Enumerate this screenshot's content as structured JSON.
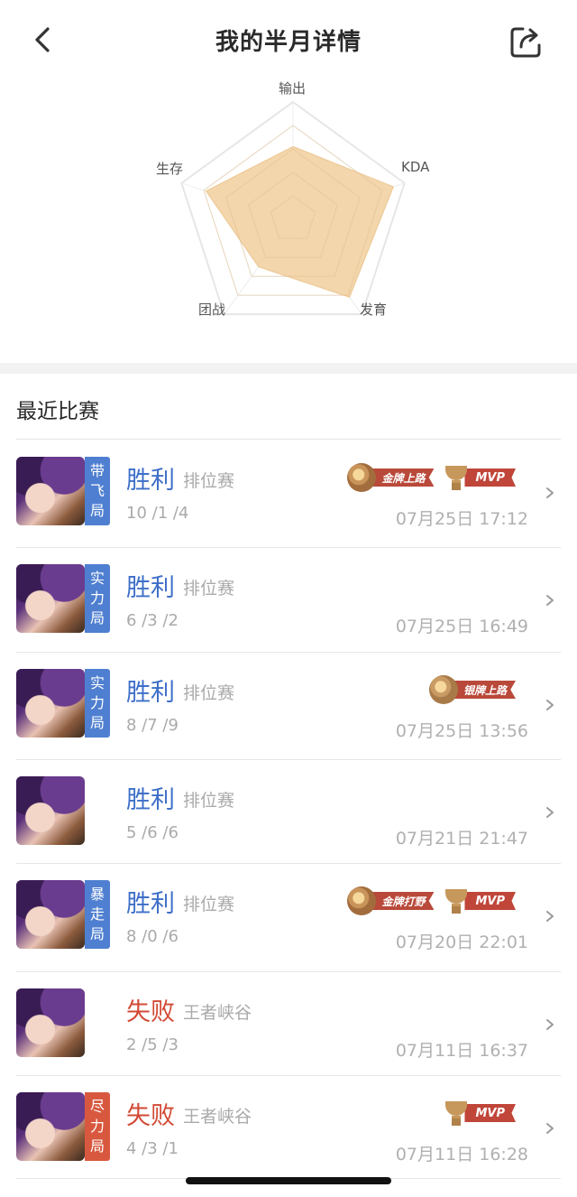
{
  "header": {
    "title": "我的半月详情",
    "back_icon": "chevron-left-icon",
    "share_icon": "share-icon"
  },
  "radar": {
    "labels": {
      "top": "输出",
      "right": "KDA",
      "bottom_right": "发育",
      "bottom_left": "团战",
      "left": "生存"
    },
    "fill_color": "#f2d3a5",
    "values": {
      "输出": 0.62,
      "KDA": 0.9,
      "发育": 0.82,
      "团战": 0.5,
      "生存": 0.78
    }
  },
  "section": {
    "title": "最近比赛"
  },
  "matches": [
    {
      "tag": [
        "带",
        "飞",
        "局"
      ],
      "tag_color": "#4f7fd0",
      "result": "胜利",
      "outcome": "win",
      "mode": "排位赛",
      "kda": "10 /1 /4",
      "time": "07月25日 17:12",
      "badges": [
        {
          "type": "gold-medal",
          "label": "金牌上路"
        },
        {
          "type": "mvp",
          "label": "MVP"
        }
      ]
    },
    {
      "tag": [
        "实",
        "力",
        "局"
      ],
      "tag_color": "#4f7fd0",
      "result": "胜利",
      "outcome": "win",
      "mode": "排位赛",
      "kda": "6 /3 /2",
      "time": "07月25日 16:49",
      "badges": []
    },
    {
      "tag": [
        "实",
        "力",
        "局"
      ],
      "tag_color": "#4f7fd0",
      "result": "胜利",
      "outcome": "win",
      "mode": "排位赛",
      "kda": "8 /7 /9",
      "time": "07月25日 13:56",
      "badges": [
        {
          "type": "silver-medal",
          "label": "银牌上路"
        }
      ]
    },
    {
      "tag": [],
      "tag_color": "",
      "result": "胜利",
      "outcome": "win",
      "mode": "排位赛",
      "kda": "5 /6 /6",
      "time": "07月21日 21:47",
      "badges": []
    },
    {
      "tag": [
        "暴",
        "走",
        "局"
      ],
      "tag_color": "#4f7fd0",
      "result": "胜利",
      "outcome": "win",
      "mode": "排位赛",
      "kda": "8 /0 /6",
      "time": "07月20日 22:01",
      "badges": [
        {
          "type": "gold-medal",
          "label": "金牌打野"
        },
        {
          "type": "mvp",
          "label": "MVP"
        }
      ]
    },
    {
      "tag": [],
      "tag_color": "",
      "result": "失败",
      "outcome": "lose",
      "mode": "王者峡谷",
      "kda": "2 /5 /3",
      "time": "07月11日 16:37",
      "badges": []
    },
    {
      "tag": [
        "尽",
        "力",
        "局"
      ],
      "tag_color": "#d8583f",
      "result": "失败",
      "outcome": "lose",
      "mode": "王者峡谷",
      "kda": "4 /3 /1",
      "time": "07月11日 16:28",
      "badges": [
        {
          "type": "mvp",
          "label": "MVP"
        }
      ]
    }
  ]
}
